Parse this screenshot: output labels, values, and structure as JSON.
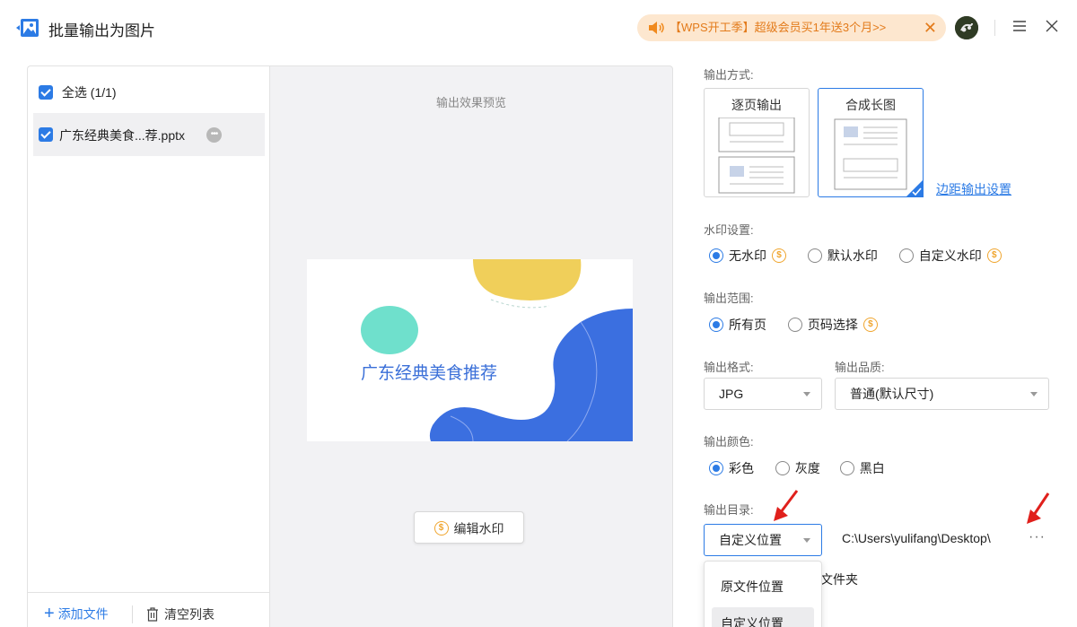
{
  "window": {
    "title": "批量输出为图片",
    "promo_text": "【WPS开工季】超级会员买1年送3个月>>",
    "promo_close": "✕"
  },
  "filelist": {
    "select_all_label": "全选 (1/1)",
    "files": [
      {
        "name": "广东经典美食...荐.pptx",
        "checked": true
      }
    ],
    "add_file_label": "添加文件",
    "clear_list_label": "清空列表"
  },
  "preview": {
    "label": "输出效果预览",
    "slide_title": "广东经典美食推荐",
    "edit_watermark_label": "编辑水印"
  },
  "settings": {
    "output_mode": {
      "label": "输出方式:",
      "options": [
        "逐页输出",
        "合成长图"
      ],
      "selected": "合成长图",
      "margin_link": "边距输出设置"
    },
    "watermark": {
      "label": "水印设置:",
      "options": [
        "无水印",
        "默认水印",
        "自定义水印"
      ],
      "selected": "无水印"
    },
    "range": {
      "label": "输出范围:",
      "options": [
        "所有页",
        "页码选择"
      ],
      "selected": "所有页"
    },
    "format": {
      "label": "输出格式:",
      "value": "JPG"
    },
    "quality": {
      "label": "输出品质:",
      "value": "普通(默认尺寸)"
    },
    "color": {
      "label": "输出颜色:",
      "options": [
        "彩色",
        "灰度",
        "黑白"
      ],
      "selected": "彩色"
    },
    "directory": {
      "label": "输出目录:",
      "value": "自定义位置",
      "path": "C:\\Users\\yulifang\\Desktop\\",
      "more": "···",
      "dropdown_options": [
        "原文件位置",
        "自定义位置"
      ],
      "folder_text": "文件夹"
    }
  },
  "colors": {
    "accent": "#2c7be5",
    "coin": "#f0a52e",
    "promo_bg": "#fde7cf",
    "annotation_arrow": "#e0201c"
  }
}
